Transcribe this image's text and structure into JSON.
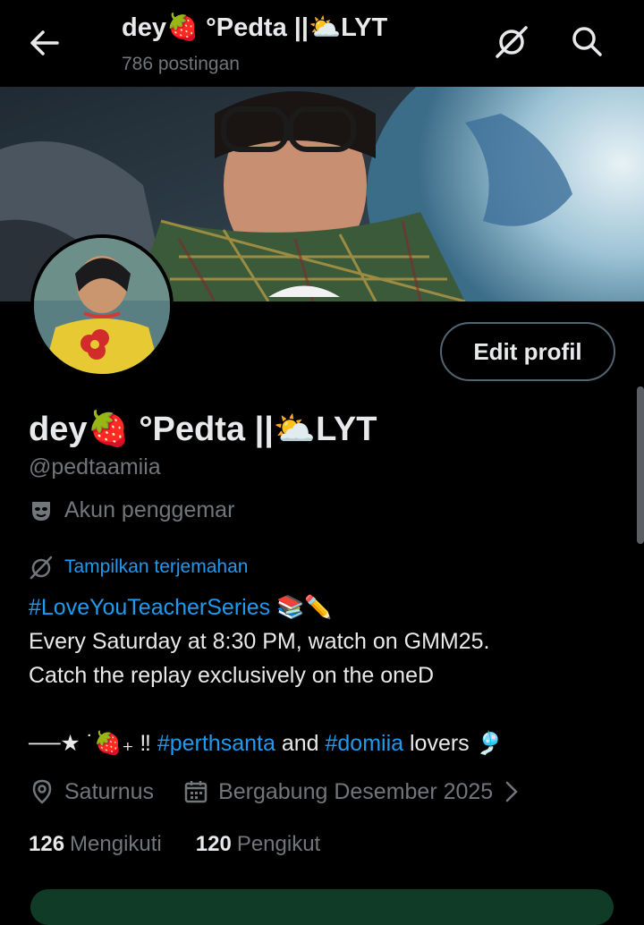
{
  "header": {
    "title": "dey🍓 °Pedta ||⛅LYT",
    "post_count": "786 postingan"
  },
  "profile": {
    "edit_button": "Edit profil",
    "display_name": "dey🍓 °Pedta ||⛅LYT",
    "handle": "@pedtaamiia",
    "account_label": "Akun penggemar",
    "translate_link": "Tampilkan terjemahan"
  },
  "bio": {
    "hashtag_main": "#LoveYouTeacherSeries",
    "hashtag_emoji": "📚✏️",
    "line2": "Every Saturday at 8:30 PM, watch on GMM25.",
    "line3": "Catch the replay exclusively on the oneD",
    "line4_prefix": "──★ ˙🍓₊ ‼ ",
    "tag1": "#perthsanta",
    "and_text": " and ",
    "tag2": "#domiia",
    "line4_suffix": " lovers 🎐"
  },
  "meta": {
    "location": "Saturnus",
    "joined": "Bergabung Desember 2025"
  },
  "stats": {
    "following_count": "126",
    "following_label": "Mengikuti",
    "followers_count": "120",
    "followers_label": "Pengikut"
  },
  "icons": {
    "back": "arrow-left-icon",
    "translate": "translate-icon",
    "search": "search-icon",
    "fan": "mask-icon",
    "location": "location-pin-icon",
    "calendar": "calendar-icon",
    "chevron": "chevron-right-icon"
  },
  "colors": {
    "link": "#1d9bf0",
    "muted": "#71767b",
    "text": "#e7e9ea"
  }
}
